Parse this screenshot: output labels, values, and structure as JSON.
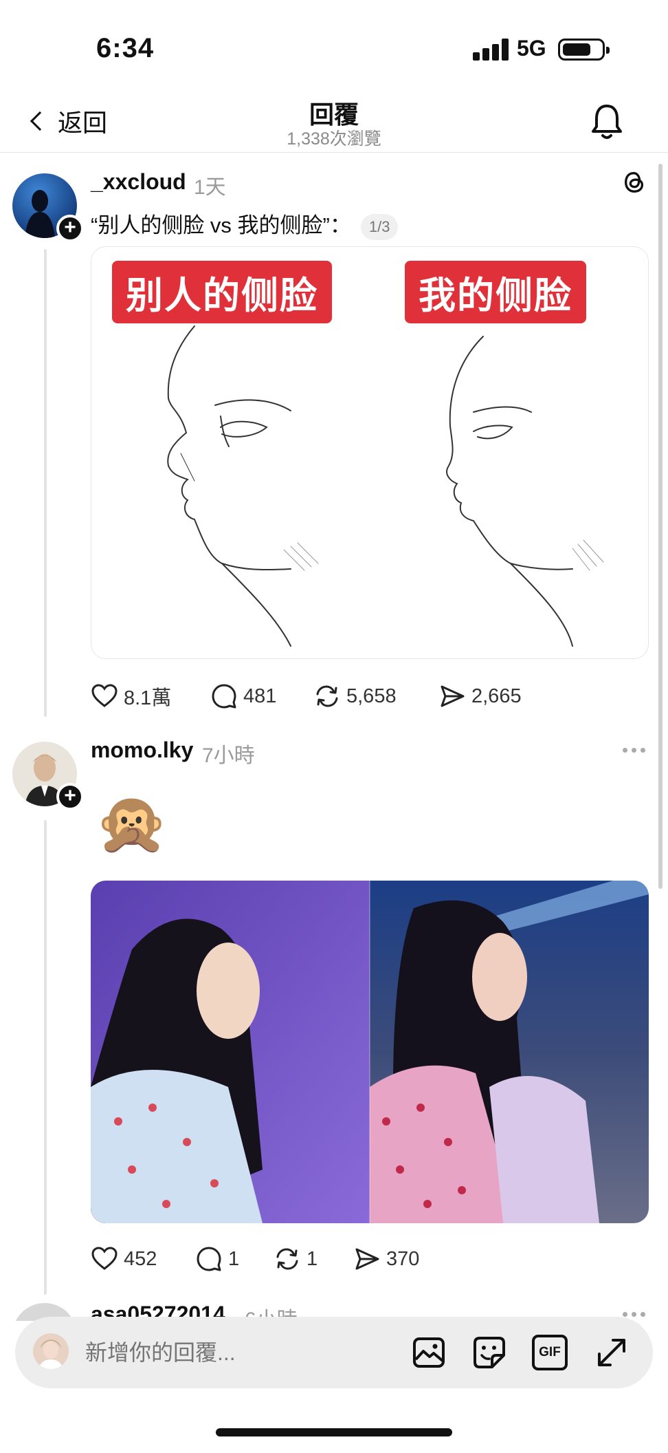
{
  "status_bar": {
    "time": "6:34",
    "network": "5G"
  },
  "header": {
    "back_label": "返回",
    "title": "回覆",
    "views": "1,338次瀏覽"
  },
  "posts": [
    {
      "username": "_xxcloud",
      "time": "1天",
      "text": "“别人的侧脸 vs 我的侧脸”：",
      "page_indicator": "1/3",
      "image_labels": [
        "别人的侧脸",
        "我的侧脸"
      ],
      "likes": "8.1萬",
      "replies": "481",
      "reposts": "5,658",
      "shares": "2,665"
    },
    {
      "username": "momo.lky",
      "time": "7小時",
      "emoji": "🙊",
      "likes": "452",
      "replies": "1",
      "reposts": "1",
      "shares": "370"
    },
    {
      "username": "asa05272014",
      "time": "6小時"
    }
  ],
  "reply_bar": {
    "placeholder": "新增你的回覆...",
    "gif_label": "GIF"
  }
}
